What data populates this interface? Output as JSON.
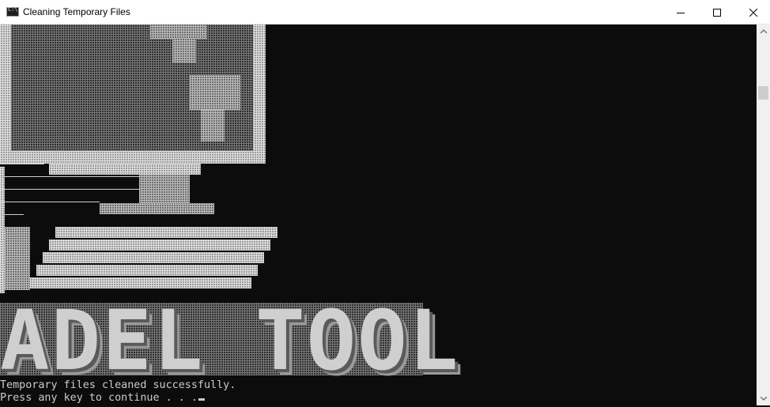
{
  "window": {
    "title": "Cleaning Temporary Files",
    "app_icon_text": "C:\\"
  },
  "banner": {
    "text": "ADEL TOOL"
  },
  "console": {
    "lines": [
      "Temporary files cleaned successfully.",
      "Press any key to continue . . ."
    ]
  },
  "colors": {
    "console_bg": "#0c0c0c",
    "console_text": "#cccccc",
    "titlebar_bg": "#ffffff"
  }
}
